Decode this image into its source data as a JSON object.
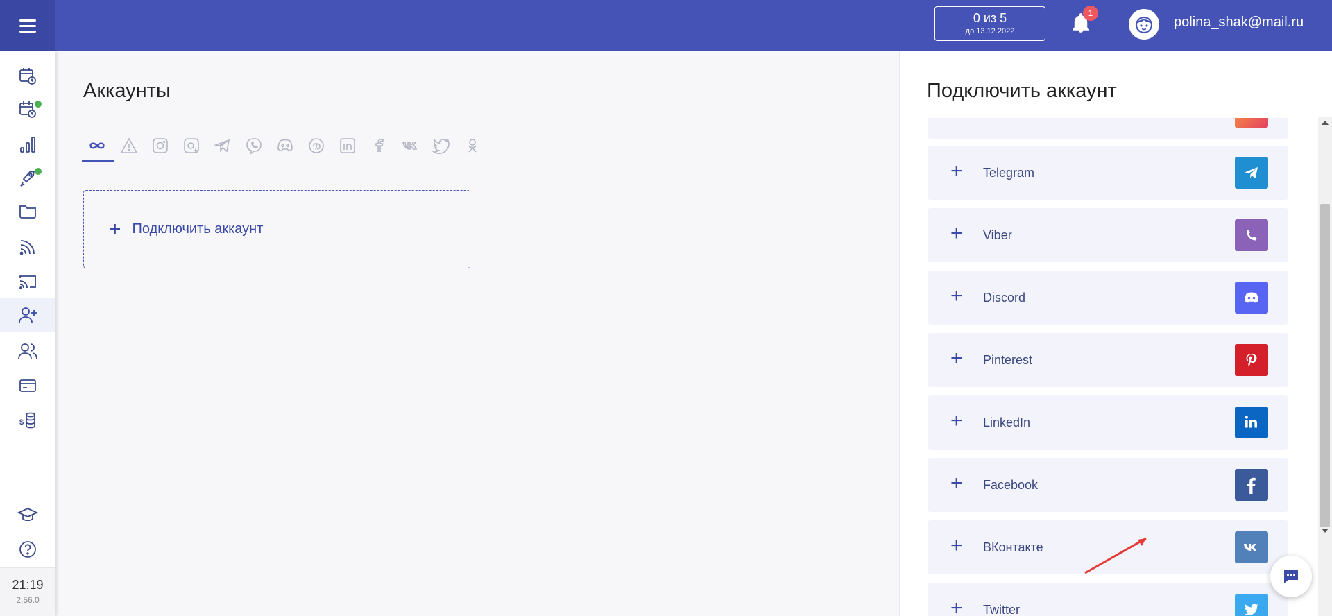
{
  "header": {
    "quota_main": "0 из 5",
    "quota_sub": "до 13.12.2022",
    "notification_count": "1",
    "user_email": "polina_shak@mail.ru"
  },
  "sidebar": {
    "items": [
      "calendar-clock-icon",
      "calendar-check-icon",
      "analytics-icon",
      "rocket-icon",
      "folder-icon",
      "rss-icon",
      "cast-icon",
      "add-user-icon",
      "users-icon",
      "card-icon",
      "money-coins-icon"
    ],
    "bottom_items": [
      "education-icon",
      "help-icon"
    ],
    "time": "21:19",
    "version": "2.56.0"
  },
  "main": {
    "title": "Аккаунты",
    "filters": [
      "all-infinity-icon",
      "warning-icon",
      "instagram-icon",
      "instagram-plus-icon",
      "telegram-icon",
      "viber-icon",
      "discord-icon",
      "pinterest-icon",
      "linkedin-icon",
      "facebook-icon",
      "vk-icon",
      "twitter-icon",
      "odnoklassniki-icon"
    ],
    "connect_label": "Подключить аккаунт"
  },
  "panel": {
    "title": "Подключить аккаунт",
    "networks": [
      {
        "name": "",
        "color": "#e4405f"
      },
      {
        "name": "Telegram",
        "color": "#1f8fd1"
      },
      {
        "name": "Viber",
        "color": "#8a62b8"
      },
      {
        "name": "Discord",
        "color": "#5865f2"
      },
      {
        "name": "Pinterest",
        "color": "#d3202a"
      },
      {
        "name": "LinkedIn",
        "color": "#0a66c2"
      },
      {
        "name": "Facebook",
        "color": "#3b5a9a"
      },
      {
        "name": "ВКонтакте",
        "color": "#5181b8"
      },
      {
        "name": "Twitter",
        "color": "#3aa9f0"
      }
    ]
  },
  "colors": {
    "header": "#4453b5",
    "accent": "#3a4aa6",
    "arrow": "#e53935"
  }
}
